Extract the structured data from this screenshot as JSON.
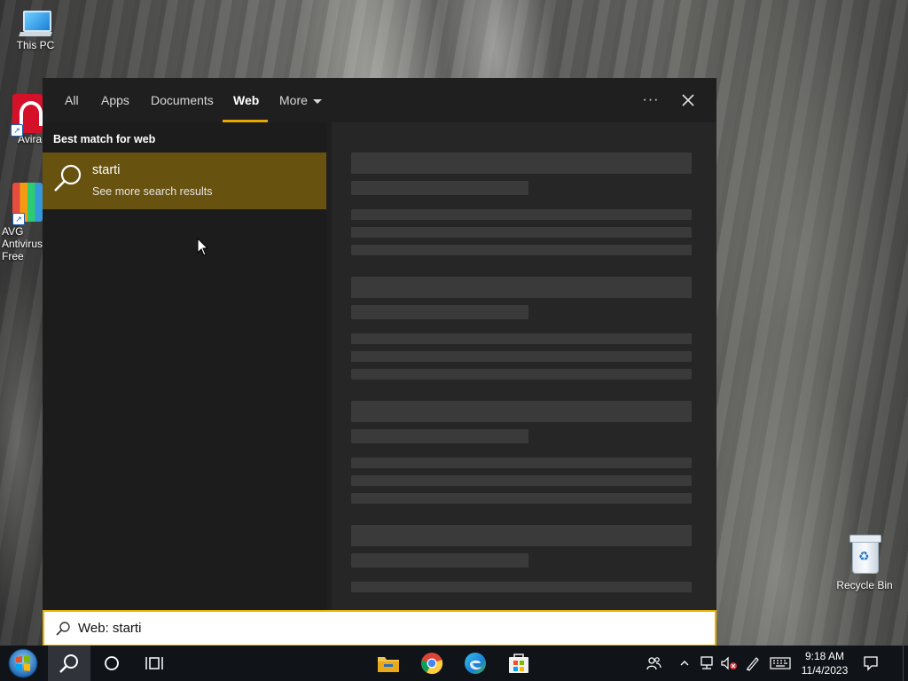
{
  "desktop": {
    "icons": [
      {
        "label": "This PC"
      },
      {
        "label": "Avira"
      },
      {
        "label": "AVG Antivirus Free"
      },
      {
        "label": "Recycle Bin"
      }
    ]
  },
  "search_panel": {
    "tabs": [
      {
        "label": "All"
      },
      {
        "label": "Apps"
      },
      {
        "label": "Documents"
      },
      {
        "label": "Web",
        "active": true
      },
      {
        "label": "More"
      }
    ],
    "section_title": "Best match for web",
    "best_match": {
      "title": "starti",
      "subtitle": "See more search results"
    },
    "more_options_label": "···",
    "accent_color": "#e8a600",
    "selection_color": "#67520f"
  },
  "searchbox": {
    "value": "Web: starti"
  },
  "taskbar": {
    "apps": [
      "start-orb",
      "search",
      "cortana",
      "task-view",
      "file-explorer",
      "chrome",
      "edge",
      "store"
    ],
    "clock": {
      "time": "9:18 AM",
      "date": "11/4/2023"
    }
  }
}
